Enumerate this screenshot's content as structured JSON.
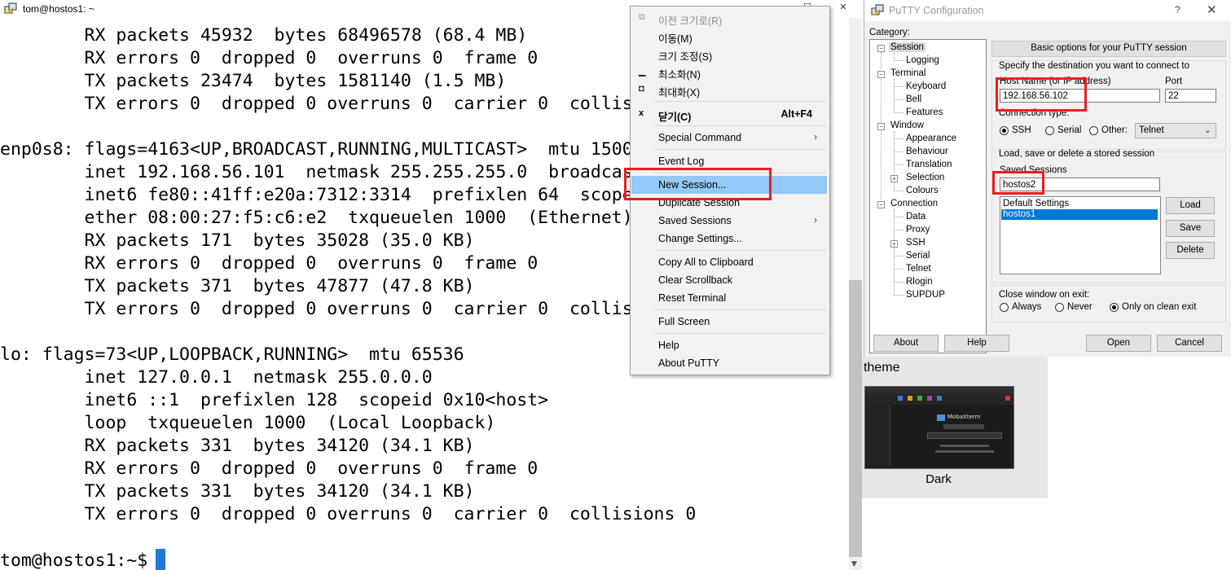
{
  "terminal": {
    "title": "tom@hostos1: ~",
    "lines": [
      "        RX packets 45932  bytes 68496578 (68.4 MB)",
      "        RX errors 0  dropped 0  overruns 0  frame 0",
      "        TX packets 23474  bytes 1581140 (1.5 MB)",
      "        TX errors 0  dropped 0 overruns 0  carrier 0  collis",
      "",
      "enp0s8: flags=4163<UP,BROADCAST,RUNNING,MULTICAST>  mtu 1500",
      "        inet 192.168.56.101  netmask 255.255.255.0  broadcas",
      "        inet6 fe80::41ff:e20a:7312:3314  prefixlen 64  scope",
      "        ether 08:00:27:f5:c6:e2  txqueuelen 1000  (Ethernet)",
      "        RX packets 171  bytes 35028 (35.0 KB)",
      "        RX errors 0  dropped 0  overruns 0  frame 0",
      "        TX packets 371  bytes 47877 (47.8 KB)",
      "        TX errors 0  dropped 0 overruns 0  carrier 0  collis",
      "",
      "lo: flags=73<UP,LOOPBACK,RUNNING>  mtu 65536",
      "        inet 127.0.0.1  netmask 255.0.0.0",
      "        inet6 ::1  prefixlen 128  scopeid 0x10<host>",
      "        loop  txqueuelen 1000  (Local Loopback)",
      "        RX packets 331  bytes 34120 (34.1 KB)",
      "        RX errors 0  dropped 0  overruns 0  frame 0",
      "        TX packets 331  bytes 34120 (34.1 KB)",
      "        TX errors 0  dropped 0 overruns 0  carrier 0  collisions 0",
      "",
      "tom@hostos1:~$"
    ],
    "cursor_color": "#1e7ad8"
  },
  "context_menu": {
    "restore": "이전 크기로(R)",
    "move": "이동(M)",
    "size": "크기 조정(S)",
    "minimize": "최소화(N)",
    "maximize": "최대화(X)",
    "close": "닫기(C)",
    "close_shortcut": "Alt+F4",
    "special_command": "Special Command",
    "event_log": "Event Log",
    "new_session": "New Session...",
    "duplicate_session": "Duplicate Session",
    "saved_sessions": "Saved Sessions",
    "change_settings": "Change Settings...",
    "copy_all": "Copy All to Clipboard",
    "clear_scrollback": "Clear Scrollback",
    "reset_terminal": "Reset Terminal",
    "full_screen": "Full Screen",
    "help": "Help",
    "about": "About PuTTY",
    "highlight_color": "#91c9f7"
  },
  "putty": {
    "title": "PuTTY Configuration",
    "help_btn": "?",
    "close_btn": "✕",
    "category_label": "Category:",
    "tree": {
      "session": "Session",
      "logging": "Logging",
      "terminal": "Terminal",
      "keyboard": "Keyboard",
      "bell": "Bell",
      "features": "Features",
      "window": "Window",
      "appearance": "Appearance",
      "behaviour": "Behaviour",
      "translation": "Translation",
      "selection": "Selection",
      "colours": "Colours",
      "connection": "Connection",
      "data": "Data",
      "proxy": "Proxy",
      "ssh": "SSH",
      "serial": "Serial",
      "telnet": "Telnet",
      "rlogin": "Rlogin",
      "supdup": "SUPDUP"
    },
    "header": "Basic options for your PuTTY session",
    "destination_label": "Specify the destination you want to connect to",
    "host_label": "Host Name (or IP address)",
    "host_value": "192.168.56.102",
    "port_label": "Port",
    "port_value": "22",
    "conn_type_label": "Connection type:",
    "conn_ssh": "SSH",
    "conn_serial": "Serial",
    "conn_other": "Other:",
    "other_value": "Telnet",
    "load_save_label": "Load, save or delete a stored session",
    "saved_sessions_label": "Saved Sessions",
    "saved_sessions_value": "hostos2",
    "sessions": [
      "Default Settings",
      "hostos1"
    ],
    "load_btn": "Load",
    "save_btn": "Save",
    "delete_btn": "Delete",
    "close_window_label": "Close window on exit:",
    "close_always": "Always",
    "close_never": "Never",
    "close_clean": "Only on clean exit",
    "about_btn": "About",
    "help_btn2": "Help",
    "open_btn": "Open",
    "cancel_btn": "Cancel"
  },
  "theme_panel": {
    "title": "theme",
    "thumb_label": "MobaXterm",
    "name": "Dark"
  },
  "annotation_color": "#ef1d1d"
}
